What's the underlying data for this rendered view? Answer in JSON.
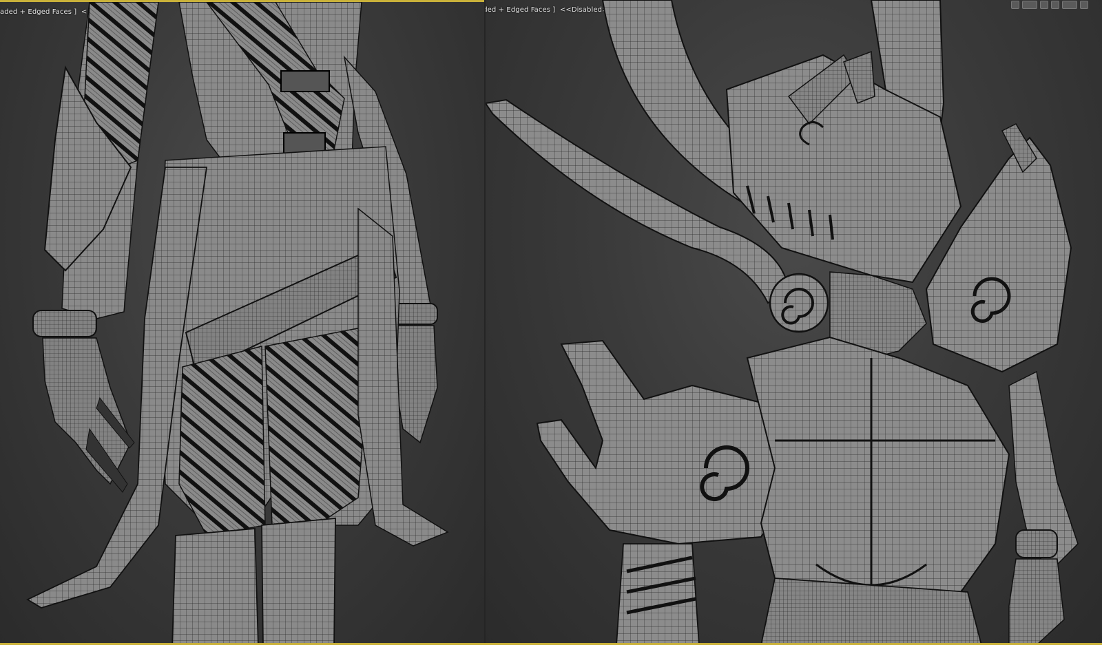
{
  "viewports": {
    "left": {
      "label": "aded + Edged Faces ]  <<Disabled>>"
    },
    "right": {
      "label": "aded + Edged Faces ]  <<Disabled>>"
    }
  },
  "toolbar": {
    "icons": [
      "render-setup-icon",
      "display-icon",
      "viewport-nav-icon",
      "orbit-icon",
      "maximize-icon",
      "settings-icon"
    ]
  },
  "colors": {
    "active_viewport_border": "#c9b13a",
    "viewport_background": "#3a3a3a",
    "mesh_fill": "#8c8c8c",
    "wireframe": "#1a1a1a"
  }
}
